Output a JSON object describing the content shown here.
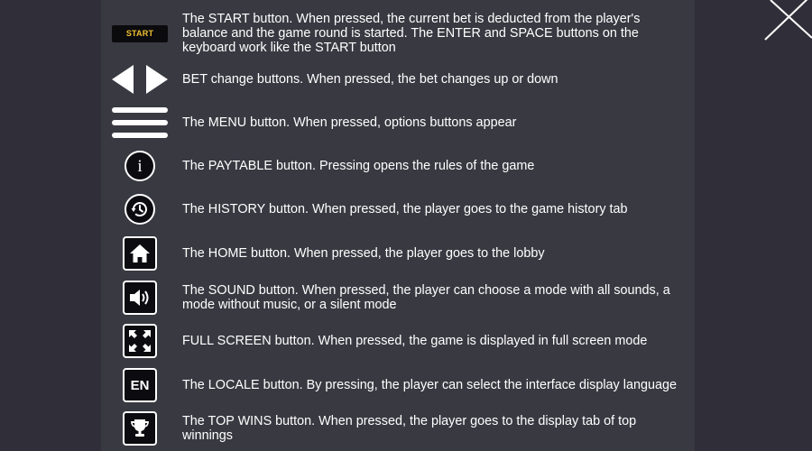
{
  "colors": {
    "background": "#302f39",
    "panel": "#393942",
    "text": "#ffffff",
    "start_badge_text": "#f1c232",
    "icon_fill": "#0c0b10"
  },
  "close": {
    "icon": "close-icon"
  },
  "rows": [
    {
      "icon": "start-badge",
      "badge_label": "START",
      "text": "The START button. When pressed, the current bet is deducted from the player's balance and the game round is started. The ENTER and SPACE buttons on the keyboard work like the START button"
    },
    {
      "icon": "bet-arrows-icon",
      "text": "BET change buttons. When pressed, the bet changes up or down"
    },
    {
      "icon": "menu-icon",
      "text": "The MENU button. When pressed, options buttons appear"
    },
    {
      "icon": "info-icon",
      "icon_glyph": "i",
      "text": "The PAYTABLE button. Pressing opens the rules of the game"
    },
    {
      "icon": "history-icon",
      "text": "The HISTORY button. When pressed, the player goes to the game history tab"
    },
    {
      "icon": "home-icon",
      "text": "The HOME button. When pressed, the player goes to the lobby"
    },
    {
      "icon": "sound-icon",
      "text": "The SOUND button. When pressed, the player can choose a mode with all sounds, a mode without music, or a silent mode"
    },
    {
      "icon": "fullscreen-icon",
      "text": "FULL SCREEN button. When pressed, the game is displayed in full screen mode"
    },
    {
      "icon": "locale-icon",
      "icon_label": "EN",
      "text": "The LOCALE button. By pressing, the player can select the interface display language"
    },
    {
      "icon": "trophy-icon",
      "text": "The TOP WINS button. When pressed, the player goes to the display tab of top winnings"
    }
  ]
}
